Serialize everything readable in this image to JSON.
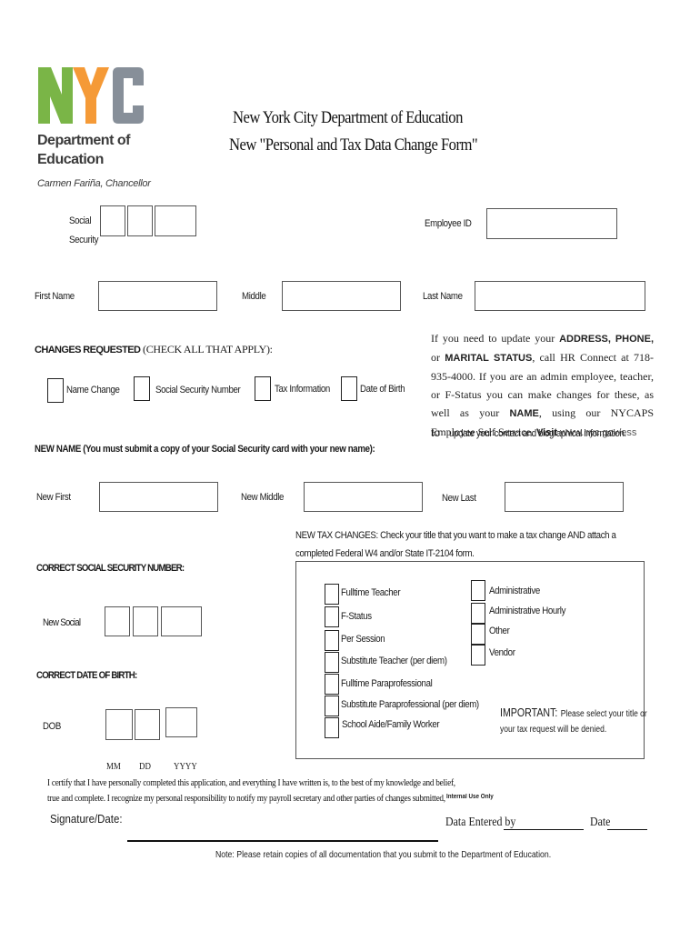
{
  "logo": {
    "letters": [
      "N",
      "Y",
      "C"
    ],
    "colors": {
      "N": "#7ab547",
      "Y": "#f59a37",
      "C": "#878f99"
    },
    "department_line1": "Department of",
    "department_line2": "Education",
    "chancellor": "Carmen Fariña, Chancellor"
  },
  "header": {
    "title_line1": "New York City Department of Education",
    "title_line2": "New \"Personal and Tax Data Change Form\""
  },
  "identity": {
    "ssn_label_line1": "Social",
    "ssn_label_line2": "Security",
    "employee_id_label": "Employee ID",
    "first_name_label": "First Name",
    "middle_label": "Middle",
    "last_name_label": "Last Name"
  },
  "changes": {
    "heading_bold": "CHANGES REQUESTED",
    "heading_rest": " (CHECK ALL THAT APPLY):",
    "options": [
      "Name Change",
      "Social Security Number",
      "Tax Information",
      "Date of Birth"
    ]
  },
  "info_box": {
    "p1_a": "If you need to update your ",
    "p1_b": "ADDRESS, PHONE,",
    "p1_c": " or ",
    "p1_d": "MARITAL STATUS",
    "p1_e": ", call HR Connect at 718-935-4000. If you are an admin employee, teacher, or F-Status you can make changes for these, as well as your ",
    "p1_f": "NAME",
    "p1_g": ", using our NYCAPS Employee Self Service. ",
    "p1_h": "Visit",
    "link": "www.nyc.gov/ess",
    "p2_to": "to",
    "p2_rest": "update your contact and biographical information."
  },
  "new_name": {
    "heading": "NEW NAME (You must submit a copy of your Social Security card with your new name):",
    "first_label": "New First",
    "middle_label": "New Middle",
    "last_label": "New Last"
  },
  "tax": {
    "heading_line1": "NEW TAX CHANGES: Check your title that you want to make a tax change AND attach a",
    "heading_line2": "completed Federal W4 and/or State IT-2104 form.",
    "left_options": [
      "Fulltime Teacher",
      "F-Status",
      "Per Session",
      "Substitute Teacher (per diem)",
      "Fulltime Paraprofessional",
      "Substitute Paraprofessional (per diem)",
      "School Aide/Family Worker"
    ],
    "right_options": [
      "Administrative",
      "Administrative Hourly",
      "Other",
      "Vendor"
    ],
    "important_label": "IMPORTANT:",
    "important_text": "Please select your title or",
    "important_text2": "your tax request will be denied."
  },
  "correct_ssn": {
    "heading": "CORRECT SOCIAL SECURITY NUMBER:",
    "label": "New Social"
  },
  "correct_dob": {
    "heading": "CORRECT DATE OF BIRTH:",
    "label": "DOB",
    "mm": "MM",
    "dd": "DD",
    "yyyy": "YYYY"
  },
  "certification": {
    "line1": "I certify that I have personally completed this application, and everything I have written is, to the best of my knowledge and belief,",
    "line2": "true and complete. I recognize my personal responsibility to notify my payroll secretary and other parties of changes submitted,",
    "signature_label": "Signature/Date:"
  },
  "internal": {
    "label": "Internal Use Only",
    "data_entered": "Data Entered by",
    "date": "Date"
  },
  "footer": {
    "note": "Note: Please retain copies of all documentation that you submit to the Department of Education."
  }
}
